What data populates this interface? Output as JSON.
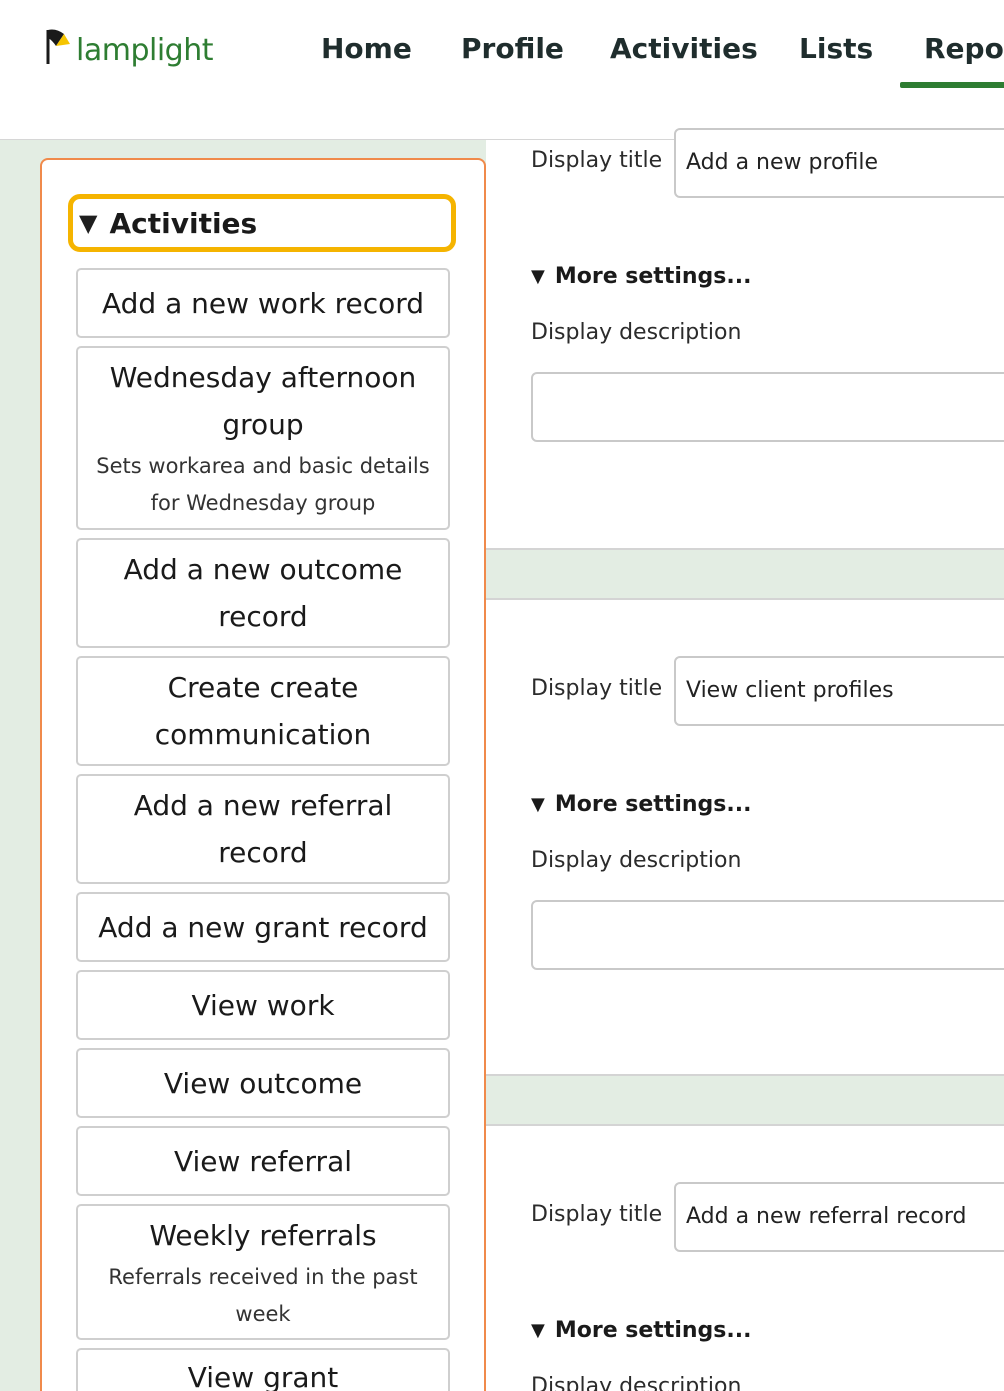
{
  "brand": {
    "name": "lamplight"
  },
  "nav": {
    "items": [
      {
        "label": "Home"
      },
      {
        "label": "Profile"
      },
      {
        "label": "Activities"
      },
      {
        "label": "Lists"
      },
      {
        "label": "Repor"
      }
    ]
  },
  "sidebar": {
    "section_title": "Activities",
    "items": [
      {
        "title": "Add a new work record",
        "desc": ""
      },
      {
        "title": "Wednesday afternoon group",
        "desc": "Sets workarea and basic details for Wednesday group"
      },
      {
        "title": "Add a new outcome record",
        "desc": ""
      },
      {
        "title": "Create create communication",
        "desc": ""
      },
      {
        "title": "Add a new referral record",
        "desc": ""
      },
      {
        "title": "Add a new grant record",
        "desc": ""
      },
      {
        "title": "View work",
        "desc": ""
      },
      {
        "title": "View outcome",
        "desc": ""
      },
      {
        "title": "View referral",
        "desc": ""
      },
      {
        "title": "Weekly referrals",
        "desc": "Referrals received in the past week"
      },
      {
        "title": "View grant",
        "desc": ""
      }
    ]
  },
  "cards": [
    {
      "display_title_label": "Display title",
      "display_title_value": "Add a new profile",
      "more_settings": "More settings...",
      "description_label": "Display description"
    },
    {
      "display_title_label": "Display title",
      "display_title_value": "View client profiles",
      "more_settings": "More settings...",
      "description_label": "Display description"
    },
    {
      "display_title_label": "Display title",
      "display_title_value": "Add a new referral record",
      "more_settings": "More settings...",
      "description_label": "Display description"
    }
  ],
  "colors": {
    "brand_green": "#2e7d32",
    "focus_ring": "#f5b400",
    "panel_border": "#f08a4b",
    "page_bg": "#e3ede3"
  },
  "icons": {
    "logo": "lamp-icon",
    "collapse": "triangle-down-icon"
  }
}
